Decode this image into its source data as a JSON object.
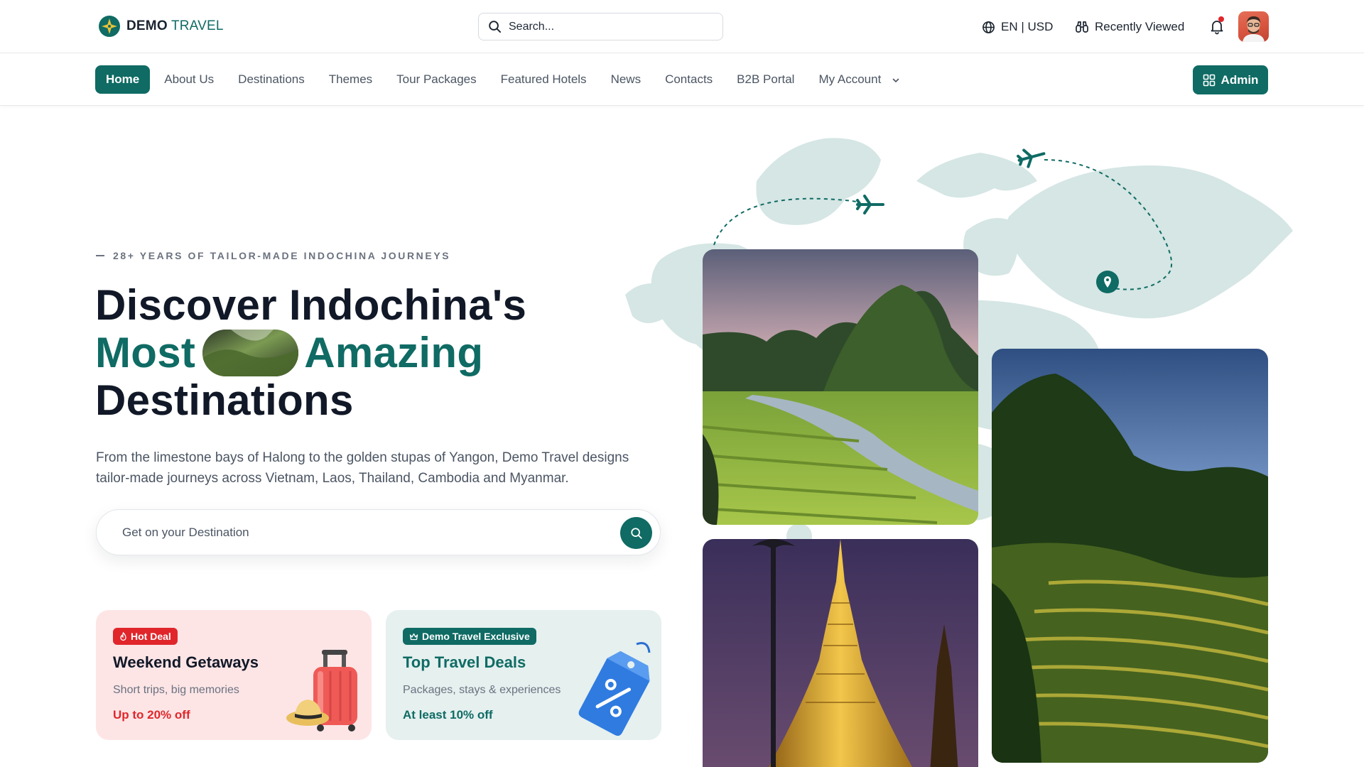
{
  "header": {
    "logo_bold": "DEMO",
    "logo_light": "TRAVEL",
    "search_placeholder": "Search...",
    "locale": "EN | USD",
    "recently_viewed": "Recently Viewed"
  },
  "nav": {
    "items": [
      {
        "label": "Home"
      },
      {
        "label": "About Us"
      },
      {
        "label": "Destinations"
      },
      {
        "label": "Themes"
      },
      {
        "label": "Tour Packages"
      },
      {
        "label": "Featured Hotels"
      },
      {
        "label": "News"
      },
      {
        "label": "Contacts"
      },
      {
        "label": "B2B Portal"
      },
      {
        "label": "My Account"
      }
    ],
    "admin_label": "Admin"
  },
  "hero": {
    "eyebrow": "28+ YEARS OF TAILOR-MADE INDOCHINA JOURNEYS",
    "title_line1": "Discover Indochina's",
    "title_accent_a": "Most",
    "title_accent_b": "Amazing",
    "title_line3": "Destinations",
    "lead": "From the limestone bays of Halong to the golden stupas of Yangon, Demo Travel designs tailor-made journeys across Vietnam, Laos, Thailand, Cambodia and Myanmar.",
    "destination_placeholder": "Get on your Destination"
  },
  "deals": [
    {
      "badge": "Hot Deal",
      "title": "Weekend Getaways",
      "subtitle": "Short trips, big memories",
      "offer": "Up to 20% off"
    },
    {
      "badge": "Demo Travel Exclusive",
      "title": "Top Travel Deals",
      "subtitle": "Packages, stays & experiences",
      "offer": "At least 10% off"
    }
  ],
  "colors": {
    "brand": "#0f6b64",
    "hot": "#e0262b",
    "map": "#d5e6e4"
  }
}
